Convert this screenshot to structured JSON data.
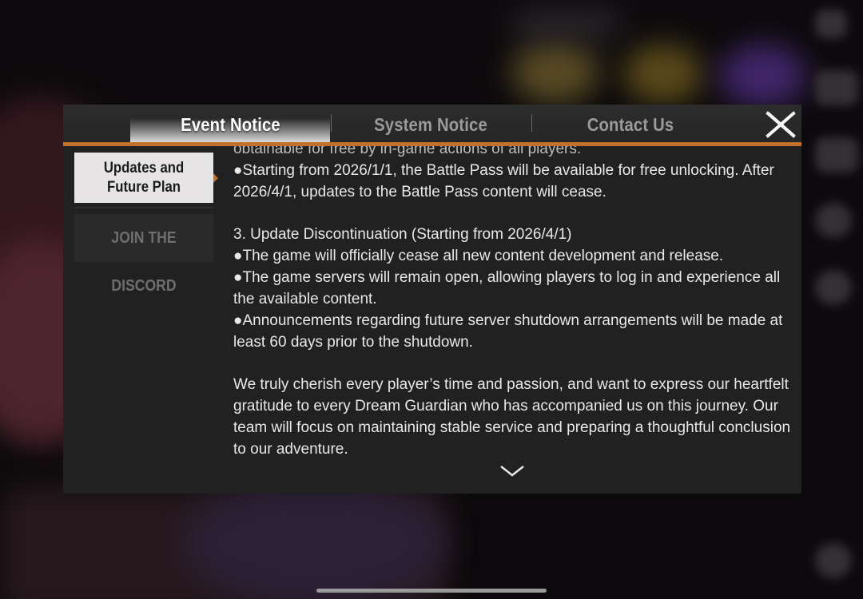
{
  "tabs": {
    "event_notice": "Event Notice",
    "system_notice": "System Notice",
    "contact_us": "Contact Us"
  },
  "menu": {
    "updates_label": "Updates and\nFuture Plan",
    "discord_label": "JOIN THE DISCORD"
  },
  "content": {
    "cut_line": "obtainable for free by in-game actions of all players.",
    "battle_pass": "●Starting from 2026/1/1, the Battle Pass will be available for free unlocking. After 2026/4/1, updates to the Battle Pass content will cease.",
    "section_title": "3. Update Discontinuation (Starting from 2026/4/1)",
    "bullet_1": "●The game will officially cease all new content development and release.",
    "bullet_2": "●The game servers will remain open, allowing players to log in and experience all the available content.",
    "bullet_3": "●Announcements regarding future server shutdown arrangements will be made at least 60 days prior to the shutdown.",
    "closing": "We truly cherish every player’s time and passion, and want to express our heartfelt gratitude to every Dream Guardian who has accompanied us on this journey. Our team will focus on maintaining stable service and preparing a thoughtful conclusion to our adventure."
  },
  "icons": {
    "close": "close-x-icon",
    "scroll": "chevron-down-icon"
  },
  "colors": {
    "accent": "#c0712b",
    "panel": "#222122",
    "text": "#e9e7e9"
  }
}
